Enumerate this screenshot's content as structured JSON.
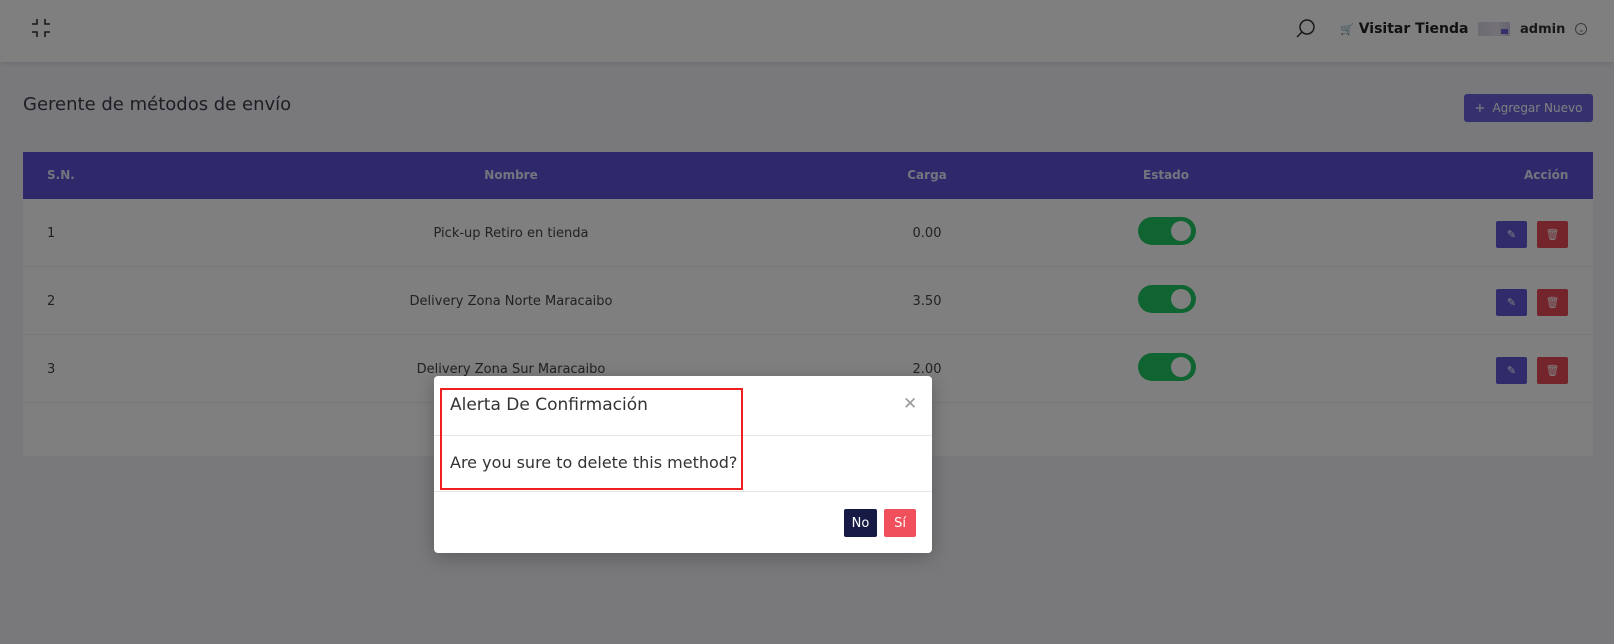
{
  "topbar": {
    "collapse_icon": "fullscreen-exit-icon",
    "search_icon": "search-icon",
    "visit_store_label": "Visitar Tienda",
    "user_name": "admin"
  },
  "page": {
    "title": "Gerente de métodos de envío",
    "add_button_label": "Agregar Nuevo"
  },
  "table": {
    "headers": {
      "sn": "S.N.",
      "name": "Nombre",
      "charge": "Carga",
      "status": "Estado",
      "action": "Acción"
    },
    "rows": [
      {
        "sn": "1",
        "name": "Pick-up Retiro en tienda",
        "charge": "0.00",
        "status_on": true
      },
      {
        "sn": "2",
        "name": "Delivery Zona Norte Maracaibo",
        "charge": "3.50",
        "status_on": true
      },
      {
        "sn": "3",
        "name": "Delivery Zona Sur Maracaibo",
        "charge": "2.00",
        "status_on": true
      }
    ]
  },
  "modal": {
    "title": "Alerta De Confirmación",
    "message": "Are you sure to delete this method?",
    "no_label": "No",
    "yes_label": "Sí"
  },
  "colors": {
    "accent": "#5b53d6",
    "danger": "#e74a57",
    "toggle_on": "#20c964",
    "highlight": "#f01f1f"
  }
}
